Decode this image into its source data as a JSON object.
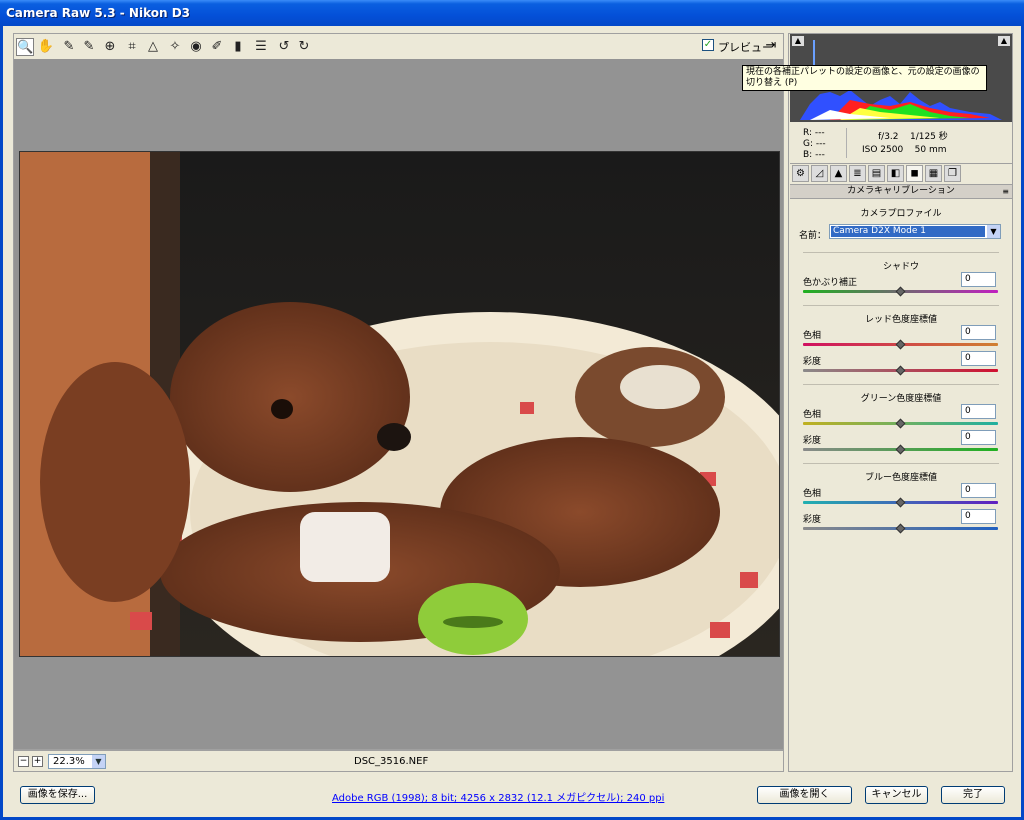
{
  "window": {
    "title": "Camera Raw 5.3  -  Nikon D3"
  },
  "toolbar": {
    "tools": [
      {
        "name": "zoom-tool-icon",
        "glyph": "🔍"
      },
      {
        "name": "hand-tool-icon",
        "glyph": "✋"
      },
      {
        "name": "white-balance-tool-icon",
        "glyph": "✎"
      },
      {
        "name": "color-sampler-tool-icon",
        "glyph": "✎"
      },
      {
        "name": "targeted-adjustment-tool-icon",
        "glyph": "⊕"
      },
      {
        "name": "crop-tool-icon",
        "glyph": "⌗"
      },
      {
        "name": "straighten-tool-icon",
        "glyph": "△"
      },
      {
        "name": "spot-removal-tool-icon",
        "glyph": "✧"
      },
      {
        "name": "red-eye-removal-tool-icon",
        "glyph": "◉"
      },
      {
        "name": "adjustment-brush-icon",
        "glyph": "✐"
      },
      {
        "name": "graduated-filter-icon",
        "glyph": "▮"
      },
      {
        "name": "preferences-icon",
        "glyph": "☰"
      },
      {
        "name": "rotate-left-icon",
        "glyph": "↺"
      },
      {
        "name": "rotate-right-icon",
        "glyph": "↻"
      }
    ],
    "preview_label": "プレビュー",
    "preview_checked": "✓",
    "toggle_glyph": "⇥"
  },
  "tooltip": {
    "text": "現在の各補正パレットの設定の画像と、元の設定の画像の切り替え (P)"
  },
  "readout": {
    "r": "R:  ---",
    "g": "G:  ---",
    "b": "B:  ---",
    "aperture": "f/3.2",
    "shutter": "1/125 秒",
    "iso": "ISO 2500",
    "focal": "50 mm"
  },
  "panel": {
    "tab_glyphs": [
      "⚙",
      "◿",
      "▲",
      "≣",
      "▤",
      "◧",
      "◼",
      "▦",
      "❐"
    ],
    "section_title": "カメラキャリブレーション",
    "section_menu": "≡",
    "profile_heading": "カメラプロファイル",
    "profile_label": "名前：",
    "profile_value": "Camera D2X Mode 1",
    "shadow_heading": "シャドウ",
    "tint_label": "色かぶり補正",
    "tint_value": "0",
    "red_heading": "レッド色度座標値",
    "red_hue_label": "色相",
    "red_hue_value": "0",
    "red_sat_label": "彩度",
    "red_sat_value": "0",
    "green_heading": "グリーン色度座標値",
    "green_hue_label": "色相",
    "green_hue_value": "0",
    "green_sat_label": "彩度",
    "green_sat_value": "0",
    "blue_heading": "ブルー色度座標値",
    "blue_hue_label": "色相",
    "blue_hue_value": "0",
    "blue_sat_label": "彩度",
    "blue_sat_value": "0"
  },
  "zoom": {
    "minus": "−",
    "plus": "+",
    "value": "22.3%",
    "dd": "▼"
  },
  "filename": "DSC_3516.NEF",
  "footer": {
    "save_label": "画像を保存...",
    "workflow_link": "Adobe RGB (1998); 8 bit; 4256 x 2832 (12.1 メガピクセル); 240 ppi",
    "open_label": "画像を開く",
    "cancel_label": "キャンセル",
    "done_label": "完了"
  },
  "colors": {
    "titlebar": "#0450d8",
    "canvas": "#939393",
    "link": "#0000ff"
  }
}
